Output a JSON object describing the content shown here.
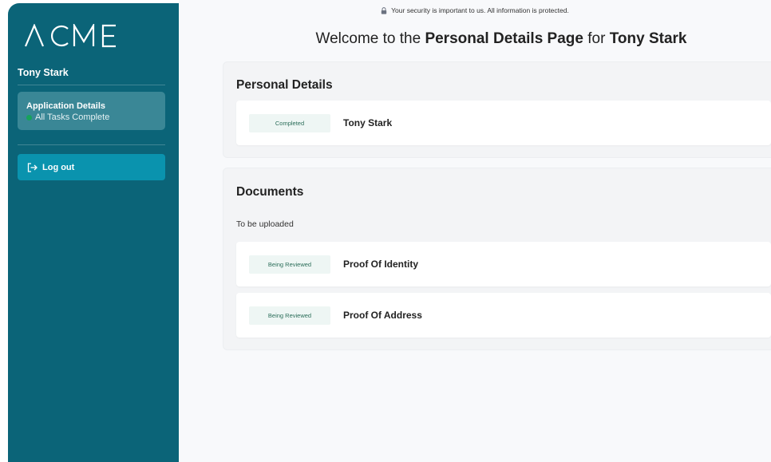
{
  "brand": {
    "logo_text": "ACME"
  },
  "sidebar": {
    "user_name": "Tony Stark",
    "application": {
      "title": "Application Details",
      "status": "All Tasks Complete"
    },
    "logout_label": "Log out"
  },
  "header": {
    "security_notice": "Your security is important to us. All information is protected.",
    "welcome": {
      "prefix": "Welcome to the ",
      "page": "Personal Details Page",
      "middle": " for ",
      "name": "Tony Stark"
    }
  },
  "personal_details": {
    "heading": "Personal Details",
    "items": [
      {
        "status": "Completed",
        "label": "Tony Stark"
      }
    ]
  },
  "documents": {
    "heading": "Documents",
    "subheading": "To be uploaded",
    "items": [
      {
        "status": "Being Reviewed",
        "label": "Proof Of Identity"
      },
      {
        "status": "Being Reviewed",
        "label": "Proof Of Address"
      }
    ]
  },
  "colors": {
    "sidebar": "#0b6478",
    "accent": "#0a93ae",
    "status_dot": "#16a35a"
  },
  "icons": {
    "lock": "lock-icon",
    "logout": "logout-icon"
  }
}
